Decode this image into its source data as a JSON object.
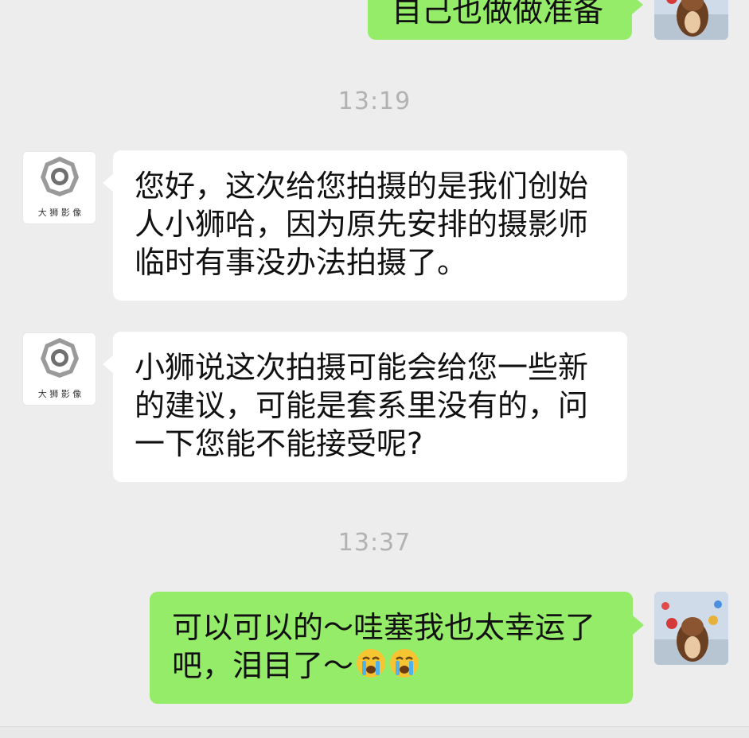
{
  "messages": {
    "top_out": {
      "text": "自己也做做准备"
    },
    "time1": "13:19",
    "in1": {
      "text": "您好，这次给您拍摄的是我们创始人小狮哈，因为原先安排的摄影师临时有事没办法拍摄了。"
    },
    "in2": {
      "text": "小狮说这次拍摄可能会给您一些新的建议，可能是套系里没有的，问一下您能不能接受呢?"
    },
    "time2": "13:37",
    "out1": {
      "text": "可以可以的～哇塞我也太幸运了吧，泪目了～"
    }
  },
  "logo": {
    "brand_text": "大 狮 影 像"
  },
  "emoji": [
    "crying-face-icon",
    "crying-face-icon"
  ],
  "colors": {
    "background": "#ededed",
    "incoming_bubble": "#ffffff",
    "outgoing_bubble": "#95ec69",
    "timestamp": "#b2b2b2"
  }
}
